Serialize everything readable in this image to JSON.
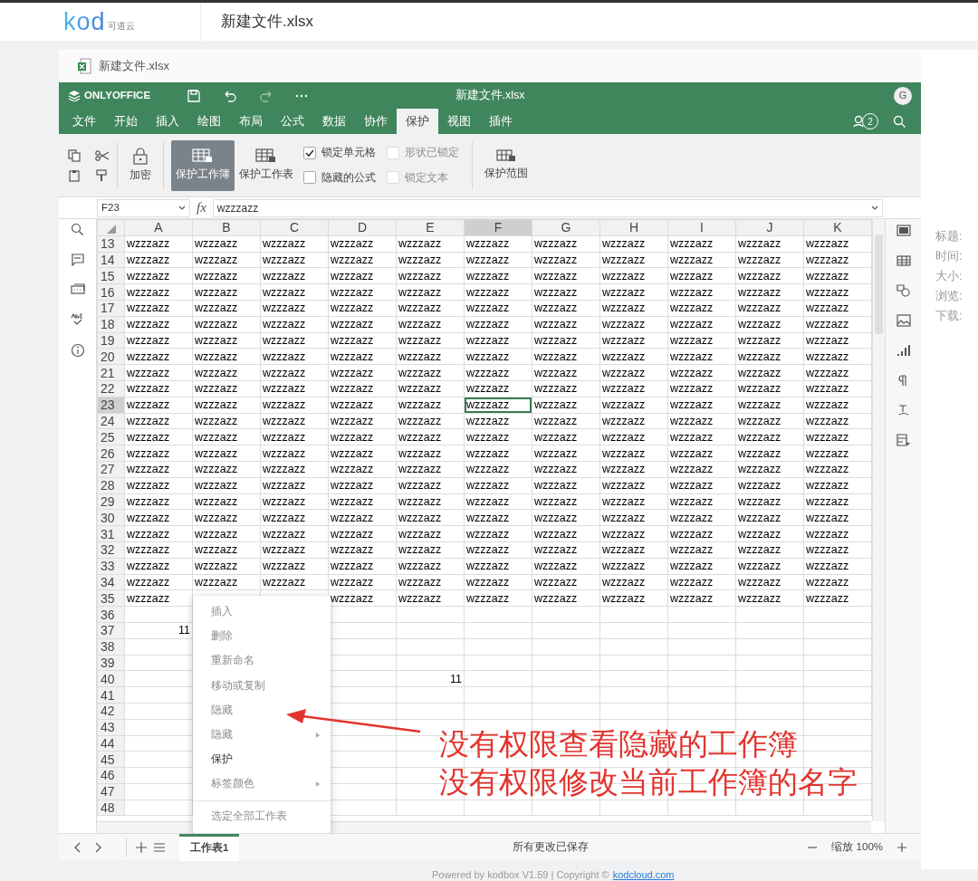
{
  "app_header": {
    "logo": "kod",
    "logo_sub": "可道云",
    "title": "新建文件.xlsx"
  },
  "file_tab": {
    "title": "新建文件.xlsx"
  },
  "editor": {
    "brand": "ONLYOFFICE",
    "title": "新建文件.xlsx",
    "avatar": "G"
  },
  "menu_tabs": [
    {
      "label": "文件",
      "selected": false
    },
    {
      "label": "开始",
      "selected": false
    },
    {
      "label": "插入",
      "selected": false
    },
    {
      "label": "绘图",
      "selected": false
    },
    {
      "label": "布局",
      "selected": false
    },
    {
      "label": "公式",
      "selected": false
    },
    {
      "label": "数据",
      "selected": false
    },
    {
      "label": "协作",
      "selected": false
    },
    {
      "label": "保护",
      "selected": true
    },
    {
      "label": "视图",
      "selected": false
    },
    {
      "label": "插件",
      "selected": false
    }
  ],
  "comments_count": "2",
  "toolbar": {
    "lock_label": "加密",
    "buttons": [
      {
        "label": "保护工作簿",
        "pressed": true
      },
      {
        "label": "保护工作表",
        "pressed": false
      }
    ],
    "checkboxes": [
      {
        "label": "锁定单元格",
        "checked": true,
        "disabled": false
      },
      {
        "label": "形状已锁定",
        "checked": false,
        "disabled": true
      },
      {
        "label": "隐藏的公式",
        "checked": false,
        "disabled": false
      },
      {
        "label": "锁定文本",
        "checked": false,
        "disabled": true
      }
    ],
    "range_label": "保护范围"
  },
  "formula_bar": {
    "cell_ref": "F23",
    "fx_label": "fx",
    "formula": "wzzzazz"
  },
  "columns": [
    {
      "label": "A",
      "selected": false
    },
    {
      "label": "B",
      "selected": false
    },
    {
      "label": "C",
      "selected": false
    },
    {
      "label": "D",
      "selected": false
    },
    {
      "label": "E",
      "selected": false
    },
    {
      "label": "F",
      "selected": true
    },
    {
      "label": "G",
      "selected": false
    },
    {
      "label": "H",
      "selected": false
    },
    {
      "label": "I",
      "selected": false
    },
    {
      "label": "J",
      "selected": false
    },
    {
      "label": "K",
      "selected": false
    }
  ],
  "rows": [
    {
      "num": "13",
      "selected": false,
      "cells": [
        "wzzzazz",
        "wzzzazz",
        "wzzzazz",
        "wzzzazz",
        "wzzzazz",
        "wzzzazz",
        "wzzzazz",
        "wzzzazz",
        "wzzzazz",
        "wzzzazz",
        "wzzzazz"
      ]
    },
    {
      "num": "14",
      "selected": false,
      "cells": [
        "wzzzazz",
        "wzzzazz",
        "wzzzazz",
        "wzzzazz",
        "wzzzazz",
        "wzzzazz",
        "wzzzazz",
        "wzzzazz",
        "wzzzazz",
        "wzzzazz",
        "wzzzazz"
      ]
    },
    {
      "num": "15",
      "selected": false,
      "cells": [
        "wzzzazz",
        "wzzzazz",
        "wzzzazz",
        "wzzzazz",
        "wzzzazz",
        "wzzzazz",
        "wzzzazz",
        "wzzzazz",
        "wzzzazz",
        "wzzzazz",
        "wzzzazz"
      ]
    },
    {
      "num": "16",
      "selected": false,
      "cells": [
        "wzzzazz",
        "wzzzazz",
        "wzzzazz",
        "wzzzazz",
        "wzzzazz",
        "wzzzazz",
        "wzzzazz",
        "wzzzazz",
        "wzzzazz",
        "wzzzazz",
        "wzzzazz"
      ]
    },
    {
      "num": "17",
      "selected": false,
      "cells": [
        "wzzzazz",
        "wzzzazz",
        "wzzzazz",
        "wzzzazz",
        "wzzzazz",
        "wzzzazz",
        "wzzzazz",
        "wzzzazz",
        "wzzzazz",
        "wzzzazz",
        "wzzzazz"
      ]
    },
    {
      "num": "18",
      "selected": false,
      "cells": [
        "wzzzazz",
        "wzzzazz",
        "wzzzazz",
        "wzzzazz",
        "wzzzazz",
        "wzzzazz",
        "wzzzazz",
        "wzzzazz",
        "wzzzazz",
        "wzzzazz",
        "wzzzazz"
      ]
    },
    {
      "num": "19",
      "selected": false,
      "cells": [
        "wzzzazz",
        "wzzzazz",
        "wzzzazz",
        "wzzzazz",
        "wzzzazz",
        "wzzzazz",
        "wzzzazz",
        "wzzzazz",
        "wzzzazz",
        "wzzzazz",
        "wzzzazz"
      ]
    },
    {
      "num": "20",
      "selected": false,
      "cells": [
        "wzzzazz",
        "wzzzazz",
        "wzzzazz",
        "wzzzazz",
        "wzzzazz",
        "wzzzazz",
        "wzzzazz",
        "wzzzazz",
        "wzzzazz",
        "wzzzazz",
        "wzzzazz"
      ]
    },
    {
      "num": "21",
      "selected": false,
      "cells": [
        "wzzzazz",
        "wzzzazz",
        "wzzzazz",
        "wzzzazz",
        "wzzzazz",
        "wzzzazz",
        "wzzzazz",
        "wzzzazz",
        "wzzzazz",
        "wzzzazz",
        "wzzzazz"
      ]
    },
    {
      "num": "22",
      "selected": false,
      "cells": [
        "wzzzazz",
        "wzzzazz",
        "wzzzazz",
        "wzzzazz",
        "wzzzazz",
        "wzzzazz",
        "wzzzazz",
        "wzzzazz",
        "wzzzazz",
        "wzzzazz",
        "wzzzazz"
      ]
    },
    {
      "num": "23",
      "selected": true,
      "cells": [
        "wzzzazz",
        "wzzzazz",
        "wzzzazz",
        "wzzzazz",
        "wzzzazz",
        "wzzzazz",
        "wzzzazz",
        "wzzzazz",
        "wzzzazz",
        "wzzzazz",
        "wzzzazz"
      ]
    },
    {
      "num": "24",
      "selected": false,
      "cells": [
        "wzzzazz",
        "wzzzazz",
        "wzzzazz",
        "wzzzazz",
        "wzzzazz",
        "wzzzazz",
        "wzzzazz",
        "wzzzazz",
        "wzzzazz",
        "wzzzazz",
        "wzzzazz"
      ]
    },
    {
      "num": "25",
      "selected": false,
      "cells": [
        "wzzzazz",
        "wzzzazz",
        "wzzzazz",
        "wzzzazz",
        "wzzzazz",
        "wzzzazz",
        "wzzzazz",
        "wzzzazz",
        "wzzzazz",
        "wzzzazz",
        "wzzzazz"
      ]
    },
    {
      "num": "26",
      "selected": false,
      "cells": [
        "wzzzazz",
        "wzzzazz",
        "wzzzazz",
        "wzzzazz",
        "wzzzazz",
        "wzzzazz",
        "wzzzazz",
        "wzzzazz",
        "wzzzazz",
        "wzzzazz",
        "wzzzazz"
      ]
    },
    {
      "num": "27",
      "selected": false,
      "cells": [
        "wzzzazz",
        "wzzzazz",
        "wzzzazz",
        "wzzzazz",
        "wzzzazz",
        "wzzzazz",
        "wzzzazz",
        "wzzzazz",
        "wzzzazz",
        "wzzzazz",
        "wzzzazz"
      ]
    },
    {
      "num": "28",
      "selected": false,
      "cells": [
        "wzzzazz",
        "wzzzazz",
        "wzzzazz",
        "wzzzazz",
        "wzzzazz",
        "wzzzazz",
        "wzzzazz",
        "wzzzazz",
        "wzzzazz",
        "wzzzazz",
        "wzzzazz"
      ]
    },
    {
      "num": "29",
      "selected": false,
      "cells": [
        "wzzzazz",
        "wzzzazz",
        "wzzzazz",
        "wzzzazz",
        "wzzzazz",
        "wzzzazz",
        "wzzzazz",
        "wzzzazz",
        "wzzzazz",
        "wzzzazz",
        "wzzzazz"
      ]
    },
    {
      "num": "30",
      "selected": false,
      "cells": [
        "wzzzazz",
        "wzzzazz",
        "wzzzazz",
        "wzzzazz",
        "wzzzazz",
        "wzzzazz",
        "wzzzazz",
        "wzzzazz",
        "wzzzazz",
        "wzzzazz",
        "wzzzazz"
      ]
    },
    {
      "num": "31",
      "selected": false,
      "cells": [
        "wzzzazz",
        "wzzzazz",
        "wzzzazz",
        "wzzzazz",
        "wzzzazz",
        "wzzzazz",
        "wzzzazz",
        "wzzzazz",
        "wzzzazz",
        "wzzzazz",
        "wzzzazz"
      ]
    },
    {
      "num": "32",
      "selected": false,
      "cells": [
        "wzzzazz",
        "wzzzazz",
        "wzzzazz",
        "wzzzazz",
        "wzzzazz",
        "wzzzazz",
        "wzzzazz",
        "wzzzazz",
        "wzzzazz",
        "wzzzazz",
        "wzzzazz"
      ]
    },
    {
      "num": "33",
      "selected": false,
      "cells": [
        "wzzzazz",
        "wzzzazz",
        "wzzzazz",
        "wzzzazz",
        "wzzzazz",
        "wzzzazz",
        "wzzzazz",
        "wzzzazz",
        "wzzzazz",
        "wzzzazz",
        "wzzzazz"
      ]
    },
    {
      "num": "34",
      "selected": false,
      "cells": [
        "wzzzazz",
        "wzzzazz",
        "wzzzazz",
        "wzzzazz",
        "wzzzazz",
        "wzzzazz",
        "wzzzazz",
        "wzzzazz",
        "wzzzazz",
        "wzzzazz",
        "wzzzazz"
      ]
    },
    {
      "num": "35",
      "selected": false,
      "cells": [
        "wzzzazz",
        null,
        null,
        "wzzzazz",
        "wzzzazz",
        "wzzzazz",
        "wzzzazz",
        "wzzzazz",
        "wzzzazz",
        "wzzzazz",
        "wzzzazz"
      ]
    },
    {
      "num": "36",
      "selected": false
    },
    {
      "num": "37",
      "selected": false,
      "cells": [
        {
          "value": "11",
          "kind": "number"
        }
      ]
    },
    {
      "num": "38",
      "selected": false
    },
    {
      "num": "39",
      "selected": false
    },
    {
      "num": "40",
      "selected": false,
      "cells": [
        null,
        null,
        null,
        null,
        {
          "value": "11",
          "kind": "number"
        }
      ]
    },
    {
      "num": "41",
      "selected": false
    },
    {
      "num": "42",
      "selected": false
    },
    {
      "num": "43",
      "selected": false
    },
    {
      "num": "44",
      "selected": false
    },
    {
      "num": "45",
      "selected": false
    },
    {
      "num": "46",
      "selected": false
    },
    {
      "num": "47",
      "selected": false
    },
    {
      "num": "48",
      "selected": false
    }
  ],
  "context_menu": [
    {
      "label": "插入",
      "disabled": true,
      "submenu": false
    },
    {
      "label": "删除",
      "disabled": true,
      "submenu": false
    },
    {
      "label": "重新命名",
      "disabled": true,
      "submenu": false
    },
    {
      "label": "移动或复制",
      "disabled": true,
      "submenu": false
    },
    {
      "label": "隐藏",
      "disabled": true,
      "submenu": false
    },
    {
      "label": "隐藏",
      "disabled": true,
      "submenu": true
    },
    {
      "label": "保护",
      "disabled": false,
      "submenu": false
    },
    {
      "label": "标签颜色",
      "disabled": true,
      "submenu": true
    },
    {
      "label": "选定全部工作表",
      "disabled": true,
      "submenu": false,
      "divider_before": true
    }
  ],
  "sheet_tabs": [
    {
      "label": "工作表1",
      "selected": true
    }
  ],
  "status": "所有更改已保存",
  "zoom": "缩放 100%",
  "info_panel": [
    "标题:",
    "时间:",
    "大小:",
    "浏览:",
    "下载:"
  ],
  "footer": {
    "text": "Powered by kodbox V1.59 | Copyright © ",
    "link": "kodcloud.com"
  },
  "annotation": [
    "没有权限查看隐藏的工作簿",
    "没有权限修改当前工作簿的名字"
  ]
}
